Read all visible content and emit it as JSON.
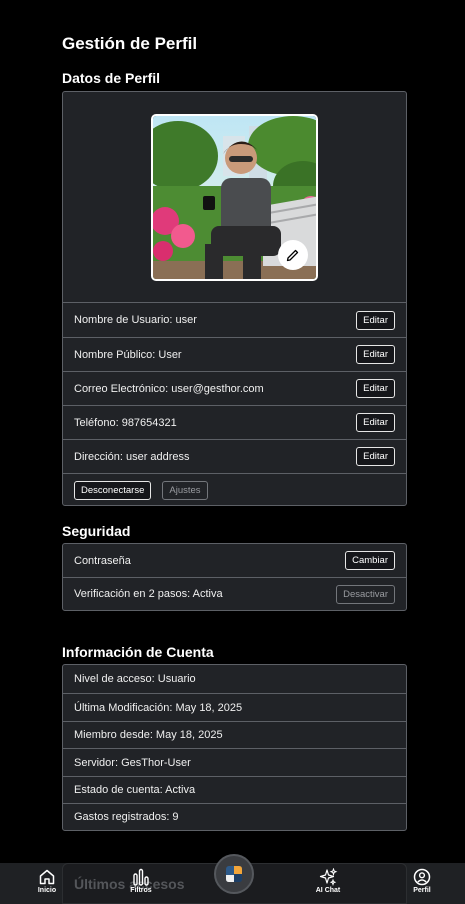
{
  "page_title": "Gestión de Perfil",
  "profile": {
    "section_title": "Datos de Perfil",
    "edit_label": "Editar",
    "fields": [
      {
        "label": "Nombre de Usuario: user"
      },
      {
        "label": "Nombre Público: User"
      },
      {
        "label": "Correo Electrónico: user@gesthor.com"
      },
      {
        "label": "Teléfono: 987654321"
      },
      {
        "label": "Dirección: user address"
      }
    ],
    "logout_label": "Desconectarse",
    "settings_label": "Ajustes"
  },
  "security": {
    "section_title": "Seguridad",
    "password_label": "Contraseña",
    "password_button": "Cambiar",
    "twofa_label": "Verificación en 2 pasos: Activa",
    "twofa_button": "Desactivar"
  },
  "account": {
    "section_title": "Información de Cuenta",
    "rows": [
      "Nivel de acceso: Usuario",
      "Última Modificación: May 18, 2025",
      "Miembro desde: May 18, 2025",
      "Servidor: GesThor-User",
      "Estado de cuenta: Activa",
      "Gastos registrados: 9"
    ]
  },
  "recent_access": {
    "section_title": "Últimos accesos"
  },
  "nav": {
    "home": "Inicio",
    "filters": "Filtros",
    "ai_chat": "AI Chat",
    "profile": "Perfil"
  },
  "colors": {
    "background": "#000000",
    "card": "#212327",
    "border": "#5d6066",
    "nav": "#1f2124"
  },
  "icons": [
    "home-icon",
    "bar-chart-icon",
    "app-logo-icon",
    "sparkles-icon",
    "user-circle-icon",
    "pencil-icon"
  ]
}
